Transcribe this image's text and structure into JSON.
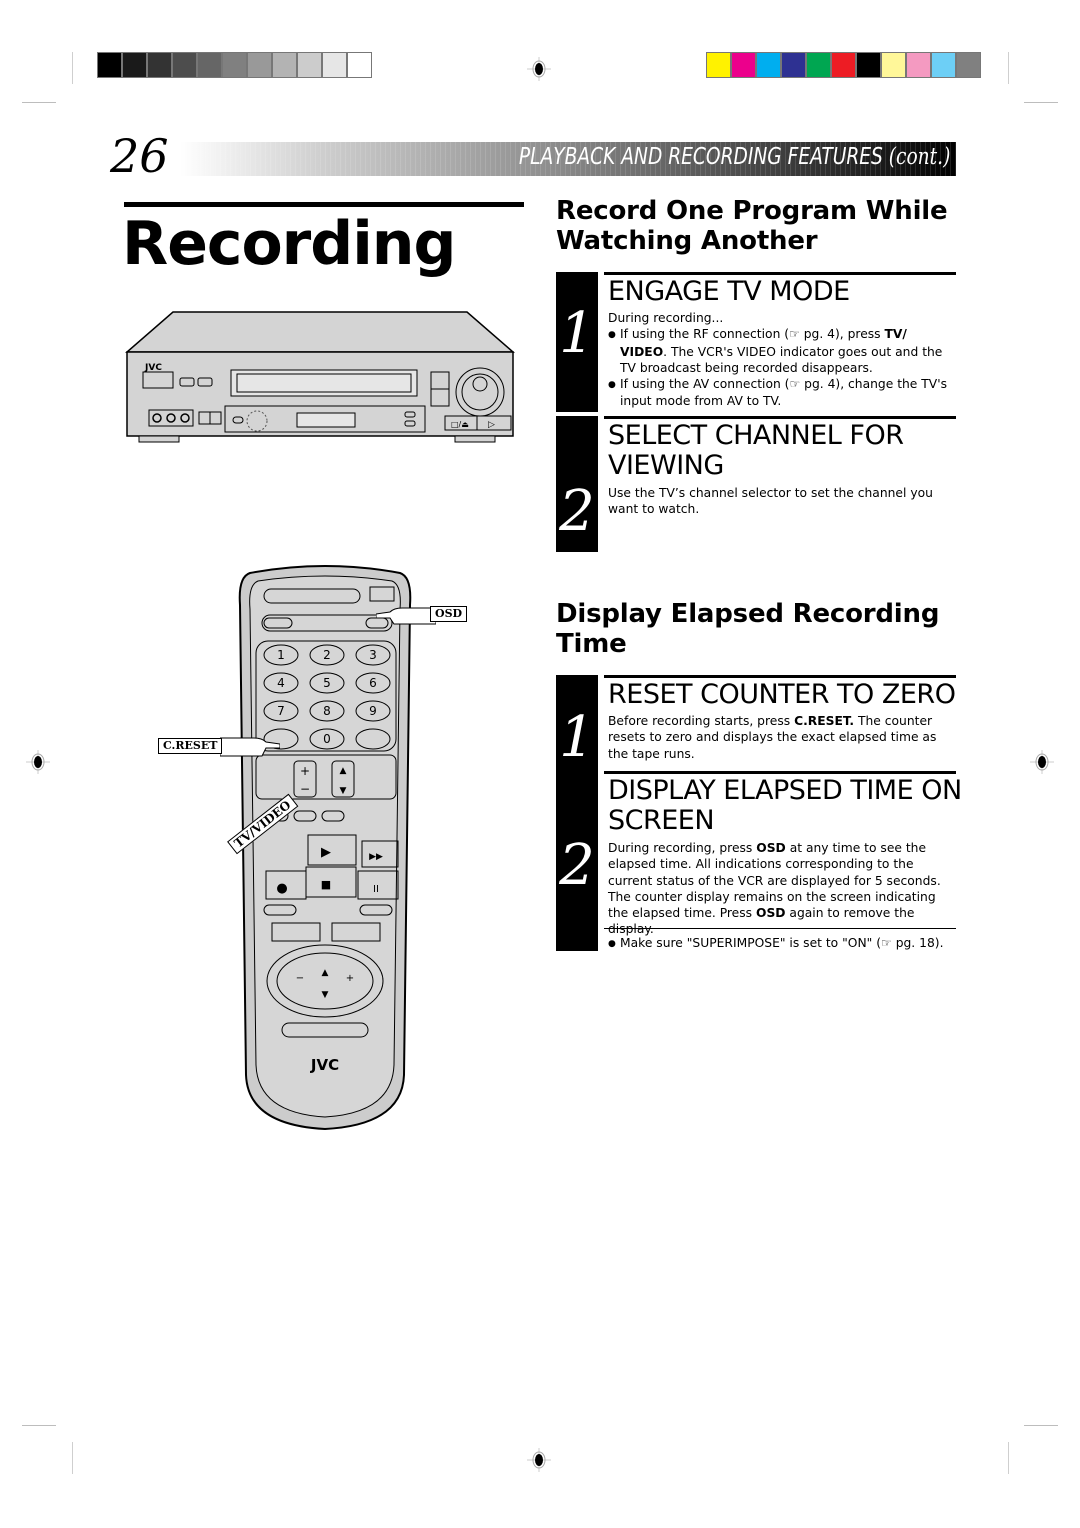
{
  "page": {
    "number": "26",
    "section_header": "PLAYBACK AND RECORDING FEATURES",
    "section_header_suffix": "(cont.)",
    "title": "Recording"
  },
  "print_marks": {
    "grayscale_bar": [
      "#000000",
      "#1a1a1a",
      "#333333",
      "#4d4d4d",
      "#666666",
      "#808080",
      "#999999",
      "#b3b3b3",
      "#cccccc",
      "#e6e6e6",
      "#ffffff"
    ],
    "color_bar": [
      "#fff200",
      "#ec008c",
      "#00aeef",
      "#2e3192",
      "#00a651",
      "#ed1c24",
      "#000000",
      "#fff799",
      "#f49ac1",
      "#6dcff6",
      "#808080"
    ]
  },
  "sections": [
    {
      "heading": "Record One Program While Watching Another",
      "heading_line1": "Record One Program While",
      "heading_line2": "Watching Another",
      "steps": [
        {
          "number": "1",
          "title": "ENGAGE TV MODE",
          "intro": "During recording...",
          "bullets": [
            {
              "pre": "If using the RF connection (",
              "ref_icon": "pointing-hand-icon",
              "mid": " pg. 4), press ",
              "bold": "TV/ VIDEO",
              "post": ". The VCR's VIDEO indicator goes out and the TV broadcast being recorded disappears."
            },
            {
              "pre": "If using the AV connection (",
              "ref_icon": "pointing-hand-icon",
              "mid": " pg. 4), change the TV's input mode from AV to TV.",
              "bold": "",
              "post": ""
            }
          ]
        },
        {
          "number": "2",
          "title": "SELECT CHANNEL FOR VIEWING",
          "title_line1": "SELECT CHANNEL FOR",
          "title_line2": "VIEWING",
          "text": "Use the TV’s channel selector to set the channel you want to watch."
        }
      ]
    },
    {
      "heading": "Display Elapsed Recording Time",
      "heading_line1": "Display Elapsed Recording",
      "heading_line2": "Time",
      "steps": [
        {
          "number": "1",
          "title": "RESET COUNTER TO ZERO",
          "text_pre": "Before recording starts, press ",
          "text_bold": "C.RESET.",
          "text_post": " The counter resets to zero and displays the exact elapsed time as the tape runs."
        },
        {
          "number": "2",
          "title": "DISPLAY ELAPSED TIME ON SCREEN",
          "title_line1": "DISPLAY ELAPSED TIME ON",
          "title_line2": "SCREEN",
          "text_a": "During recording, press ",
          "text_b": "OSD",
          "text_c": " at any time to see the elapsed time. All indications corresponding to the current status of the VCR are displayed for 5 seconds. The counter display remains on the screen indicating the elapsed time. Press ",
          "text_d": "OSD",
          "text_e": " again to remove the display.",
          "note_pre": "Make sure \"SUPERIMPOSE\" is set to \"ON\" (",
          "note_post": " pg. 18)."
        }
      ]
    }
  ],
  "illustrations": {
    "vcr": {
      "brand": "JVC"
    },
    "remote": {
      "brand": "JVC",
      "callouts": {
        "osd": "OSD",
        "creset": "C.RESET",
        "tvvideo": "TV/VIDEO"
      },
      "keypad": [
        "1",
        "2",
        "3",
        "4",
        "5",
        "6",
        "7",
        "8",
        "9",
        "0"
      ]
    }
  }
}
